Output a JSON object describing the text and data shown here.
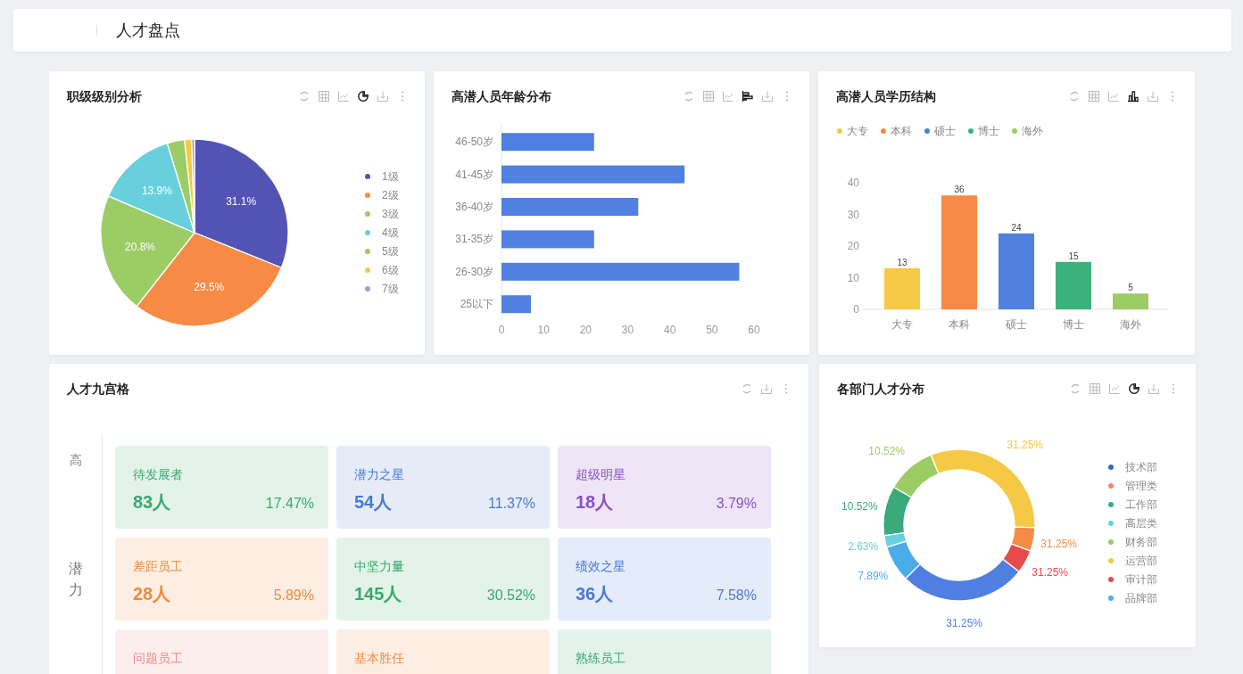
{
  "page": {
    "title": "人才盘点"
  },
  "grade_panel": {
    "title": "职级级别分析",
    "tools": [
      {
        "kind": "refresh",
        "selected": false
      },
      {
        "kind": "table",
        "selected": false
      },
      {
        "kind": "line",
        "selected": false
      },
      {
        "kind": "pie",
        "selected": true
      },
      {
        "kind": "download",
        "selected": false
      },
      {
        "kind": "more",
        "selected": false
      }
    ],
    "chart_data": {
      "type": "pie",
      "categories": [
        "1级",
        "2级",
        "3级",
        "4级",
        "5级",
        "6级",
        "7级"
      ],
      "values": [
        31.1,
        29.5,
        20.8,
        13.9,
        3.0,
        1.2,
        0.5
      ],
      "value_labels": [
        "31.1%",
        "29.5%",
        "20.8%",
        "13.9%",
        null,
        null,
        null
      ],
      "colors": [
        "#5353b5",
        "#f68b45",
        "#9ccc65",
        "#67d0dc",
        "#9ccc66",
        "#f5c944",
        "#a29ed0"
      ],
      "legend": "right"
    }
  },
  "age_panel": {
    "title": "高潜人员年龄分布",
    "tools": [
      {
        "kind": "refresh",
        "selected": false
      },
      {
        "kind": "table",
        "selected": false
      },
      {
        "kind": "line",
        "selected": false
      },
      {
        "kind": "hbar",
        "selected": true
      },
      {
        "kind": "download",
        "selected": false
      },
      {
        "kind": "more",
        "selected": false
      }
    ],
    "chart_data": {
      "type": "bar",
      "orientation": "horizontal",
      "categories": [
        "46-50岁",
        "41-45岁",
        "36-40岁",
        "31-35岁",
        "26-30岁",
        "25以下"
      ],
      "values": [
        22,
        43.5,
        32.5,
        22,
        56.5,
        7
      ],
      "colors": [
        "#5080e0",
        "#5080e0",
        "#5080e0",
        "#5080e0",
        "#5080e0",
        "#5080e0"
      ],
      "xlim": [
        0,
        60
      ],
      "xticks": [
        0,
        10,
        20,
        30,
        40,
        50,
        60
      ]
    }
  },
  "education_panel": {
    "title": "高潜人员学历结构",
    "tools": [
      {
        "kind": "refresh",
        "selected": false
      },
      {
        "kind": "table",
        "selected": false
      },
      {
        "kind": "line",
        "selected": false
      },
      {
        "kind": "bar",
        "selected": true
      },
      {
        "kind": "download",
        "selected": false
      },
      {
        "kind": "more",
        "selected": false
      }
    ],
    "chart_data": {
      "type": "bar",
      "orientation": "vertical",
      "stacked": true,
      "categories": [
        "大专",
        "本科",
        "硕士",
        "博士",
        "海外"
      ],
      "series": [
        {
          "name": "大专",
          "color": "#f5c944",
          "values": [
            13,
            null,
            null,
            null,
            null
          ]
        },
        {
          "name": "本科",
          "color": "#f68b45",
          "values": [
            null,
            36,
            null,
            null,
            null
          ]
        },
        {
          "name": "硕士",
          "color": "#5080e0",
          "values": [
            null,
            null,
            24,
            null,
            null
          ]
        },
        {
          "name": "博士",
          "color": "#3bb27b",
          "values": [
            null,
            null,
            null,
            15,
            null
          ]
        },
        {
          "name": "海外",
          "color": "#9ccc65",
          "values": [
            null,
            null,
            null,
            null,
            5
          ]
        }
      ],
      "ylim": [
        0,
        40
      ],
      "yticks": [
        0,
        10,
        20,
        30,
        40
      ],
      "data_labels": true,
      "legend": "top"
    }
  },
  "grid_panel": {
    "title": "人才九宫格",
    "tools": [
      {
        "kind": "refresh",
        "selected": false
      },
      {
        "kind": "download",
        "selected": false
      },
      {
        "kind": "more",
        "selected": false
      }
    ],
    "axis_labels": [
      "高",
      "潜力"
    ],
    "cells": [
      {
        "title": "待发展者",
        "count": "83人",
        "share": "17.47%",
        "color": "#3aa86b"
      },
      {
        "title": "潜力之星",
        "count": "54人",
        "share": "11.37%",
        "color": "#4a78d0"
      },
      {
        "title": "超级明星",
        "count": "18人",
        "share": "3.79%",
        "color": "#8a4fc8"
      },
      {
        "title": "差距员工",
        "count": "28人",
        "share": "5.89%",
        "color": "#f08a3c"
      },
      {
        "title": "中坚力量",
        "count": "145人",
        "share": "30.52%",
        "color": "#3aa86c"
      },
      {
        "title": "绩效之星",
        "count": "36人",
        "share": "7.58%",
        "color": "#4a78d1"
      },
      {
        "title": "问题员工",
        "color": "#ee8a8a"
      },
      {
        "title": "基本胜任",
        "color": "#f08a3d"
      },
      {
        "title": "熟练员工",
        "color": "#3aa86d"
      }
    ]
  },
  "department_panel": {
    "title": "各部门人才分布",
    "tools": [
      {
        "kind": "refresh",
        "selected": false
      },
      {
        "kind": "table",
        "selected": false
      },
      {
        "kind": "line",
        "selected": false
      },
      {
        "kind": "pie",
        "selected": true
      },
      {
        "kind": "download",
        "selected": false
      },
      {
        "kind": "more",
        "selected": false
      }
    ],
    "slice_labels": [
      {
        "text": "31.25%",
        "color": "#f5c944"
      },
      {
        "text": "10.52%",
        "color": "#9ccc65"
      },
      {
        "text": "10.52%",
        "color": "#3aaa7a"
      },
      {
        "text": "31.25%",
        "color": "#f68b45"
      },
      {
        "text": "2.63%",
        "color": "#67d0dc"
      },
      {
        "text": "31.25%",
        "color": "#e84a4a"
      },
      {
        "text": "7.89%",
        "color": "#4aade8"
      },
      {
        "text": "31.25%",
        "color": "#4f7fe0"
      }
    ],
    "legend": [
      {
        "label": "技术部",
        "color": "#2f6fb3"
      },
      {
        "label": "管理类",
        "color": "#f08a5b"
      },
      {
        "label": "工作部",
        "color": "#3aaa7b"
      },
      {
        "label": "高层类",
        "color": "#67d0dd"
      },
      {
        "label": "财务部",
        "color": "#9ccc66"
      },
      {
        "label": "运营部",
        "color": "#f5c945"
      },
      {
        "label": "审计部",
        "color": "#e84a4b"
      },
      {
        "label": "品牌部",
        "color": "#4aade9"
      }
    ]
  }
}
